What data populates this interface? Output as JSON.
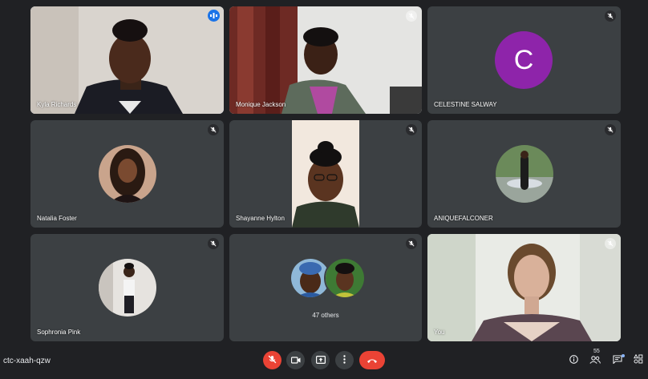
{
  "participants": [
    {
      "name": "Kyla Richards",
      "state": "speaking"
    },
    {
      "name": "Monique Jackson",
      "state": "muted"
    },
    {
      "name": "CELESTINE SALWAY",
      "state": "muted",
      "initial": "C",
      "avatar_color": "#8e24aa"
    },
    {
      "name": "Natalia Foster",
      "state": "muted"
    },
    {
      "name": "Shayanne Hylton",
      "state": "muted"
    },
    {
      "name": "ANIQUEFALCONER",
      "state": "muted"
    },
    {
      "name": "Sophronia Pink",
      "state": "muted"
    },
    {
      "name": "",
      "state": "muted",
      "others_label": "47 others"
    },
    {
      "name": "You",
      "state": "muted"
    }
  ],
  "meeting": {
    "code": "ctc-xaah-qzw",
    "participant_count": "55"
  },
  "colors": {
    "end_call": "#ea4335",
    "mic_off": "#ea4335",
    "accent": "#8ab4f8",
    "speaking": "#1a73e8"
  },
  "icons": {
    "controls": [
      "mic-off-icon",
      "camera-icon",
      "present-screen-icon",
      "more-options-icon",
      "end-call-icon"
    ],
    "right": [
      "info-icon",
      "people-icon",
      "chat-icon",
      "activities-icon"
    ]
  }
}
